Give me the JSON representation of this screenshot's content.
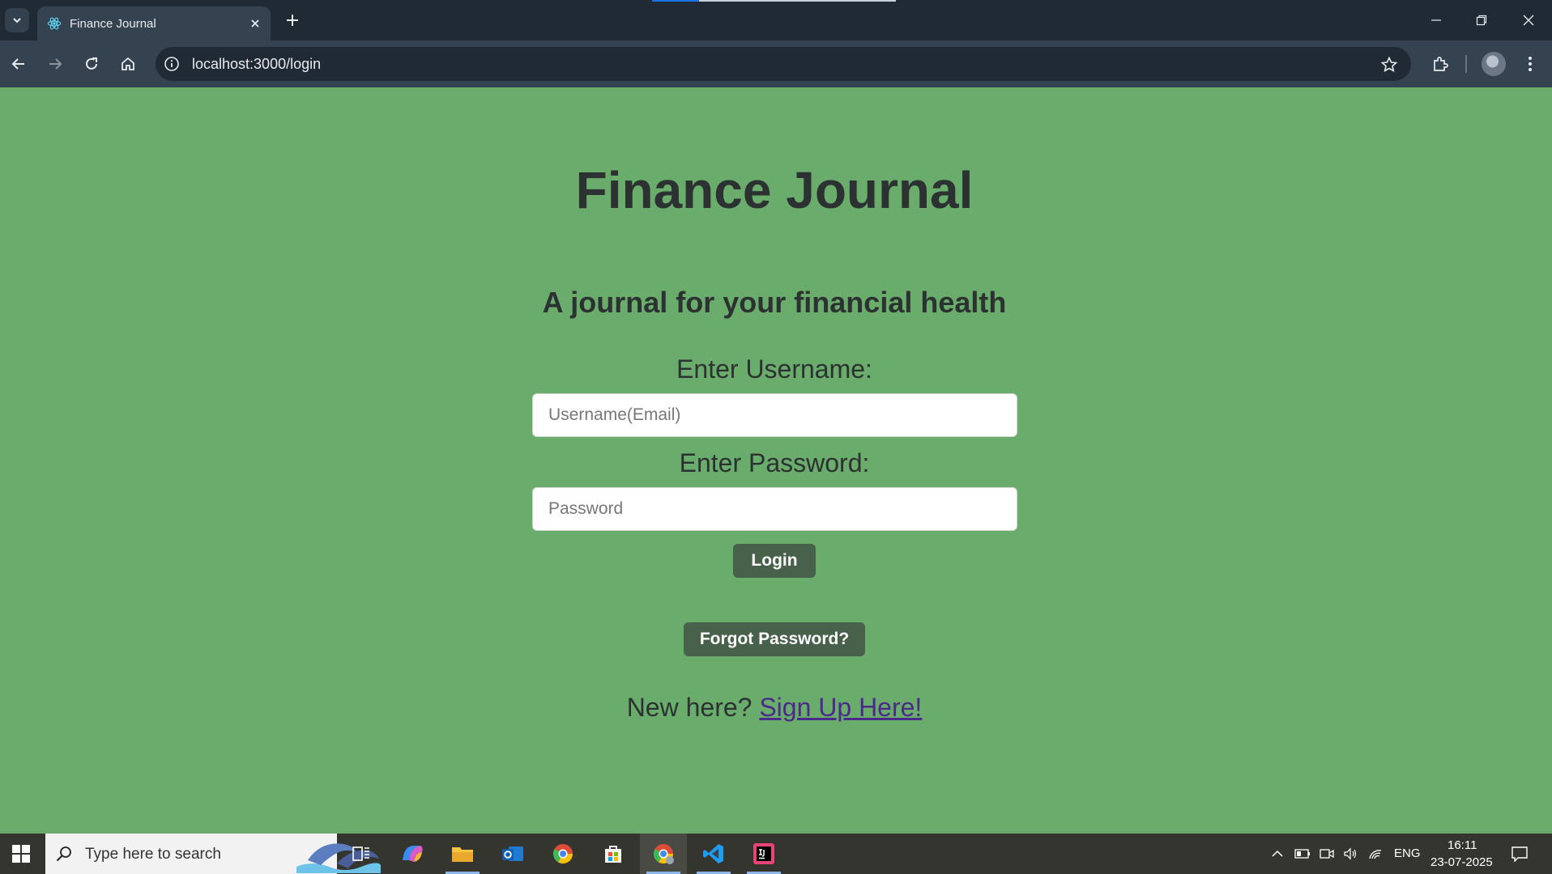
{
  "browser": {
    "tab_title": "Finance Journal",
    "url": "localhost:3000/login"
  },
  "page": {
    "title": "Finance Journal",
    "subtitle": "A journal for your financial health",
    "username_label": "Enter Username:",
    "username_placeholder": "Username(Email)",
    "password_label": "Enter Password:",
    "password_placeholder": "Password",
    "login_button": "Login",
    "forgot_button": "Forgot Password?",
    "signup_prompt": "New here?",
    "signup_link": "Sign Up Here!"
  },
  "taskbar": {
    "search_placeholder": "Type here to search",
    "language": "ENG",
    "time": "16:11",
    "date": "23-07-2025"
  },
  "colors": {
    "page_background": "#6aac6b",
    "button_background": "#47614a",
    "link": "#4a2a8a"
  }
}
